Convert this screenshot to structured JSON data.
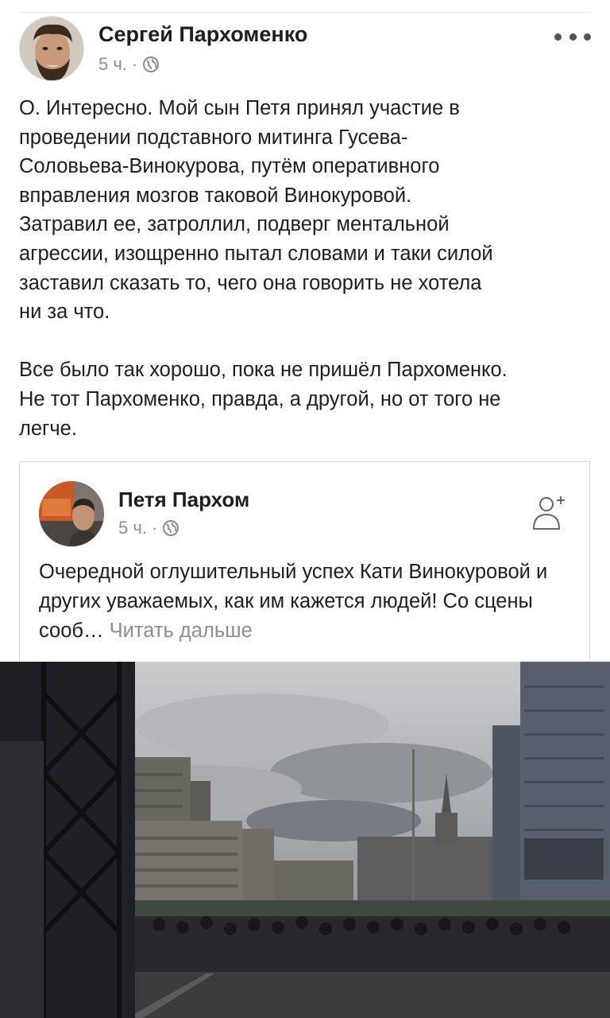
{
  "post": {
    "author": "Сергей Пархоменко",
    "time": "5 ч.",
    "separator": "·",
    "audience_icon": "globe-icon",
    "more_icon": "more-options-icon",
    "text": "О. Интересно. Мой сын Петя принял участие в\nпроведении подставного митинга Гусева-\nСоловьева-Винокурова, путём оперативного\nвправления мозгов таковой Винокуровой.\nЗатравил ее, затроллил, подверг ментальной\nагрессии, изощренно пытал словами и таки силой\nзаставил сказать то, чего она говорить не хотела\nни за что.\n\nВсе было так хорошо, пока не пришёл Пархоменко.\nНе тот Пархоменко, правда, а другой, но от того не\nлегче."
  },
  "shared": {
    "author": "Петя Пархом",
    "time": "5 ч.",
    "separator": "·",
    "audience_icon": "globe-icon",
    "action_icon": "add-friend-icon",
    "text": "Очередной оглушительный успех Кати Винокуровой и других уважаемых, как им кажется людей! Со сцены сооб…",
    "see_more": "Читать дальше"
  },
  "photo": {
    "description_icon": "rally-photo"
  }
}
